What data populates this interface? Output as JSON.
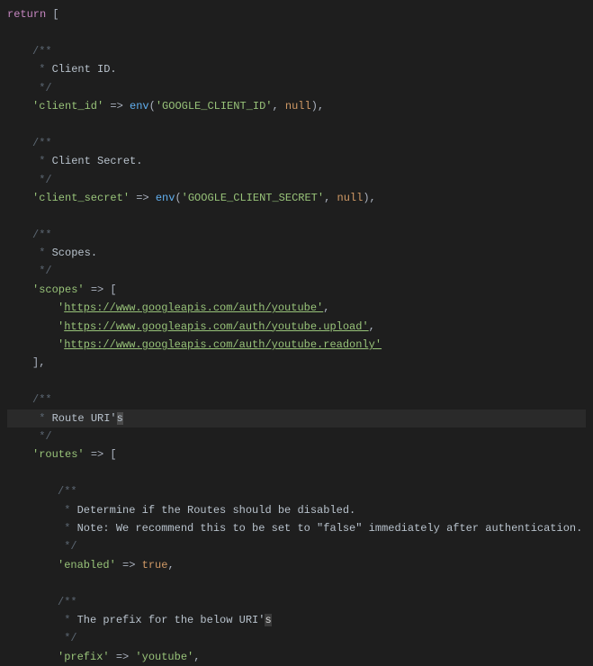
{
  "code": {
    "return_kw": "return",
    "bracket_open": "[",
    "bracket_close": "]",
    "comment_open": "/**",
    "comment_prefix": " * ",
    "comment_end": " */",
    "arrow": "=>",
    "client_id": {
      "doc": "Client ID.",
      "key": "'client_id'",
      "func": "env",
      "arg1": "'GOOGLE_CLIENT_ID'",
      "arg2": "null"
    },
    "client_secret": {
      "doc": "Client Secret.",
      "key": "'client_secret'",
      "func": "env",
      "arg1": "'GOOGLE_CLIENT_SECRET'",
      "arg2": "null"
    },
    "scopes": {
      "doc": "Scopes.",
      "key": "'scopes'",
      "urls": [
        "'https://www.googleapis.com/auth/youtube'",
        "'https://www.googleapis.com/auth/youtube.upload'",
        "'https://www.googleapis.com/auth/youtube.readonly'"
      ]
    },
    "routes": {
      "doc_pre": "Route URI'",
      "doc_cur": "s",
      "key": "'routes'",
      "enabled": {
        "doc1": "Determine if the Routes should be disabled.",
        "doc2": "Note: We recommend this to be set to \"false\" immediately after authentication.",
        "key": "'enabled'",
        "val": "true"
      },
      "prefix": {
        "doc_pre": "The prefix for the below URI'",
        "doc_sel": "s",
        "key": "'prefix'",
        "val": "'youtube'"
      }
    }
  }
}
